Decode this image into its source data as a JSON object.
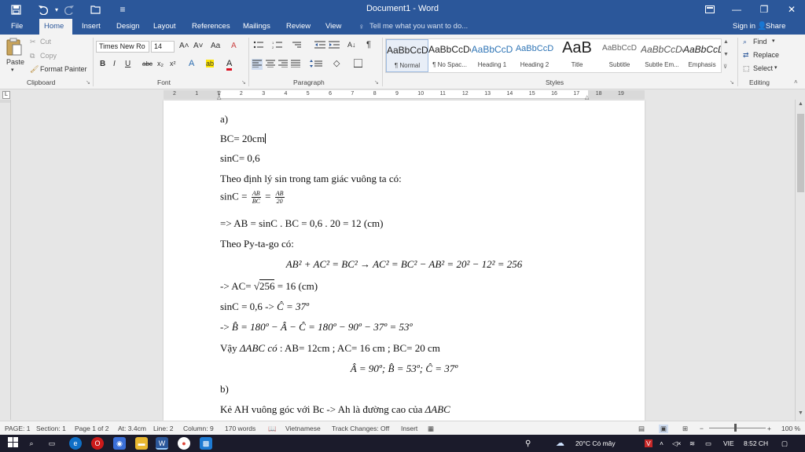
{
  "window": {
    "title": "Document1 - Word",
    "minimize": "—",
    "restore": "❐",
    "close": "✕",
    "ribbon_display": "▭"
  },
  "quick_access": {
    "save_icon": "💾",
    "undo_icon": "↶",
    "redo_icon": "↷",
    "open_icon": "📂",
    "customize_icon": "≡"
  },
  "tabs": {
    "file": "File",
    "home": "Home",
    "insert": "Insert",
    "design": "Design",
    "layout": "Layout",
    "references": "References",
    "mailings": "Mailings",
    "review": "Review",
    "view": "View",
    "tell_me": "Tell me what you want to do...",
    "sign_in": "Sign in",
    "share": "Share"
  },
  "clipboard": {
    "paste": "Paste",
    "cut": "Cut",
    "copy": "Copy",
    "format_painter": "Format Painter",
    "label": "Clipboard"
  },
  "font": {
    "name": "Times New Ro",
    "size": "14",
    "label": "Font",
    "grow": "A˄",
    "shrink": "A˅",
    "change_case": "Aa",
    "clear": "A",
    "bold": "B",
    "italic": "I",
    "underline": "U",
    "strike": "abc",
    "subscript": "x₂",
    "superscript": "x²",
    "effects": "A",
    "highlight": "ab",
    "color": "A"
  },
  "paragraph": {
    "label": "Paragraph",
    "sort": "A↓",
    "show_marks": "¶"
  },
  "styles": {
    "label": "Styles",
    "items": [
      {
        "preview": "AaBbCcDc",
        "name": "¶ Normal"
      },
      {
        "preview": "AaBbCcDc",
        "name": "¶ No Spac..."
      },
      {
        "preview": "AaBbCcD",
        "name": "Heading 1"
      },
      {
        "preview": "AaBbCcD",
        "name": "Heading 2"
      },
      {
        "preview": "AaB",
        "name": "Title"
      },
      {
        "preview": "AaBbCcD",
        "name": "Subtitle"
      },
      {
        "preview": "AaBbCcDc",
        "name": "Subtle Em..."
      },
      {
        "preview": "AaBbCcDc",
        "name": "Emphasis"
      }
    ]
  },
  "editing": {
    "find": "Find",
    "replace": "Replace",
    "select": "Select",
    "label": "Editing"
  },
  "ruler_numbers": [
    "2",
    "1",
    "1",
    "2",
    "3",
    "4",
    "5",
    "6",
    "7",
    "8",
    "9",
    "10",
    "11",
    "12",
    "13",
    "14",
    "15",
    "16",
    "17",
    "18",
    "19"
  ],
  "document": {
    "l1": "a)",
    "l2": "BC= 20cm",
    "l3": "sinC= 0,6",
    "l4": "Theo định lý sin trong tam giác vuông ta có:",
    "l5_prefix": "sinC = ",
    "l5_f1_num": "AB",
    "l5_f1_den": "BC",
    "l5_eq": " = ",
    "l5_f2_num": "AB",
    "l5_f2_den": "20",
    "l6": "=> AB = sinC . BC = 0,6 . 20 = 12 (cm)",
    "l7": "Theo Py-ta-go có:",
    "l8": "AB² + AC² = BC² → AC² = BC² − AB² =  20² − 12² = 256",
    "l9_prefix": "-> AC= √",
    "l9_root": "256",
    "l9_suffix": " = 16 (cm)",
    "l10_prefix": "sinC = 0,6 -> ",
    "l10_math": "Ĉ =  37º",
    "l11_prefix": "-> ",
    "l11_math": "B̂ =  180º −  Â − Ĉ = 180º − 90º − 37º = 53º",
    "l12_prefix": "Vậy ",
    "l12_math": "ΔABC có",
    "l12_suffix": " : AB= 12cm ; AC= 16 cm ; BC= 20 cm",
    "l13": "Â = 90º;  B̂ = 53º; Ĉ =  37º",
    "l14": "b)",
    "l15_prefix": "Kẻ AH vuông góc với Bc -> Ah là đường cao của ",
    "l15_math": "ΔABC"
  },
  "status": {
    "page": "PAGE: 1",
    "section": "Section: 1",
    "page_of": "Page 1 of 2",
    "at": "At: 3.4cm",
    "line": "Line: 2",
    "column": "Column: 9",
    "words": "170 words",
    "language": "Vietnamese",
    "track": "Track Changes: Off",
    "insert": "Insert",
    "zoom": "100 %"
  },
  "taskbar": {
    "weather": "20°C  Có mây",
    "lang": "VIE",
    "time": "8:52 CH"
  },
  "colors": {
    "accent": "#2b579a"
  }
}
